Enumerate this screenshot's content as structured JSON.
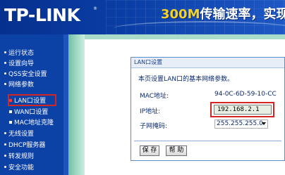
{
  "header": {
    "logo": "TP-LINK",
    "trademark": "®",
    "slogan_highlight": "300M",
    "slogan_rest": "传输速率，实现"
  },
  "menu": {
    "items": [
      {
        "label": "运行状态"
      },
      {
        "label": "设置向导"
      },
      {
        "label": "QSS安全设置"
      },
      {
        "label": "网络参数"
      },
      {
        "label": "LAN口设置"
      },
      {
        "label": "WAN口设置"
      },
      {
        "label": "MAC地址克隆"
      },
      {
        "label": "无线设置"
      },
      {
        "label": "DHCP服务器"
      },
      {
        "label": "转发规则"
      },
      {
        "label": "安全功能"
      }
    ]
  },
  "panel": {
    "title": "LAN口设置",
    "description": "本页设置LAN口的基本网络参数。",
    "mac_label": "MAC地址:",
    "mac_value": "94-0C-6D-59-10-CC",
    "ip_label": "IP地址:",
    "ip_value": "192.168.2.1",
    "mask_label": "子网掩码:",
    "mask_value": "255.255.255.0",
    "save_label": "保 存",
    "help_label": "帮 助"
  },
  "colors": {
    "banner": "#0a3ea6",
    "menu_bg": "#0c41a6",
    "highlight_box": "#d42424",
    "accent_text": "#f6d126"
  }
}
